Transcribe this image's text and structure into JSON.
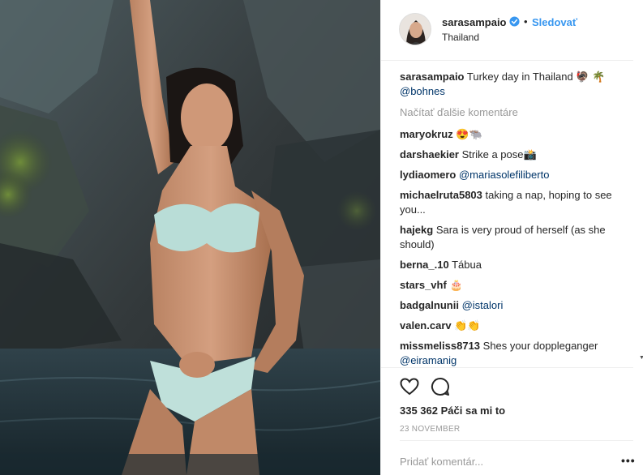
{
  "post_image": {
    "icon": "photo-woman-in-water"
  },
  "header": {
    "username": "sarasampaio",
    "separator": "•",
    "follow_label": "Sledovať",
    "location": "Thailand",
    "verified_icon": "verified-badge-icon"
  },
  "caption": {
    "username": "sarasampaio",
    "text": "Turkey day in Thailand 🦃 🌴",
    "mention": "@bohnes"
  },
  "load_more_label": "Načítať ďalšie komentáre",
  "comments": [
    {
      "username": "maryokruz",
      "text": "😍🐃",
      "mention": ""
    },
    {
      "username": "darshaekier",
      "text": "Strike a pose📸",
      "mention": ""
    },
    {
      "username": "lydiaomero",
      "text": "",
      "mention": "@mariasolefiliberto"
    },
    {
      "username": "michaelruta5803",
      "text": "taking a nap, hoping to see you...",
      "mention": ""
    },
    {
      "username": "hajekg",
      "text": "Sara is very proud of herself (as she should)",
      "mention": ""
    },
    {
      "username": "berna_.10",
      "text": "Tábua",
      "mention": ""
    },
    {
      "username": "stars_vhf",
      "text": "🎂",
      "mention": ""
    },
    {
      "username": "badgalnunii",
      "text": "",
      "mention": "@istalori"
    },
    {
      "username": "valen.carv",
      "text": "👏👏",
      "mention": ""
    },
    {
      "username": "missmeliss8713",
      "text": "Shes your doppleganger",
      "mention": "@eiramanig"
    }
  ],
  "actions": {
    "like_icon": "heart-icon",
    "comment_icon": "comment-bubble-icon"
  },
  "likes_label": "335 362 Páči sa mi to",
  "date": "23 NOVEMBER",
  "add_comment": {
    "placeholder": "Pridať komentár..."
  },
  "more_options": "•••",
  "colors": {
    "link": "#3897f0",
    "mention": "#003569",
    "muted": "#999999",
    "text": "#262626"
  }
}
